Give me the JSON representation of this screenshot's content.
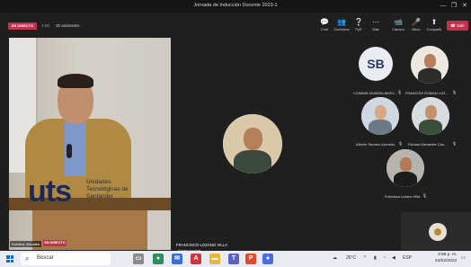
{
  "window": {
    "title": "Jornada de Inducción Docente 2023-1",
    "controls": [
      "—",
      "❐",
      "✕"
    ]
  },
  "topbar": {
    "live_badge": "EN DIRECTO",
    "timer": "1:06",
    "attendees": "35 asistentes",
    "buttons": [
      {
        "label": "Chat",
        "icon": "chat-icon",
        "glyph": "💬"
      },
      {
        "label": "Contactos",
        "icon": "people-icon",
        "glyph": "👥"
      },
      {
        "label": "PyR",
        "icon": "qa-icon",
        "glyph": "❔"
      },
      {
        "label": "Más",
        "icon": "more-icon",
        "glyph": "⋯"
      },
      {
        "label": "Cámara",
        "icon": "camera-icon",
        "glyph": "📹"
      },
      {
        "label": "Micro",
        "icon": "mic-icon",
        "glyph": "🎤"
      },
      {
        "label": "Compartir",
        "icon": "share-icon",
        "glyph": "⬆"
      }
    ],
    "leave_label": "Salir"
  },
  "stage": {
    "podium_logo": "uts",
    "podium_text": "Unidades Tecnológicas de Santander",
    "presenter_name": "Eventos Virtuales",
    "live_badge": "EN DIRECTO"
  },
  "participants": {
    "sb_initials": "SB",
    "sb_name": "COMINIA SANDRA BARO...",
    "francois_name": "FRANCOIS ROMAN LOZ...",
    "alberto_name": "Alberto Serrano Acevedo",
    "richard_name": "Richard Alexander Cás...",
    "francisco_name": "Francisco Lozano Villa"
  },
  "screen_label": "FRANCISCO LOZANO VILLA",
  "tooltip": "Adobe Acrobat",
  "taskbar": {
    "search_placeholder": "Buscar",
    "weather": "26°C",
    "lang": "ESP",
    "time": "3:58 p. m.",
    "date": "24/02/2023"
  },
  "colors": {
    "live": "#c4314b",
    "teams_bg": "#1f1f1f",
    "taskbar": "#e8ecf2"
  }
}
